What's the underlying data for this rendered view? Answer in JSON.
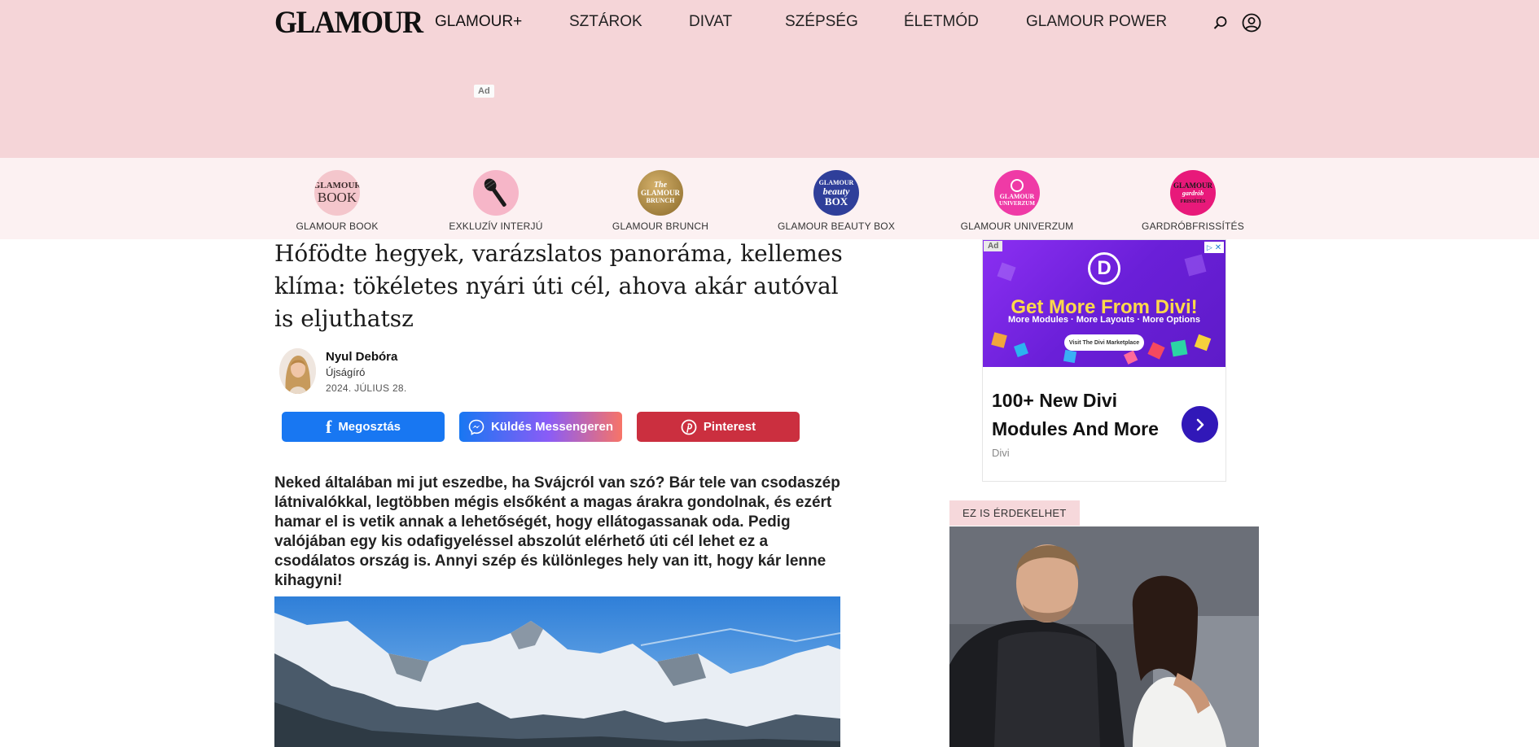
{
  "header": {
    "logo": "GLAMOUR",
    "nav": [
      "GLAMOUR+",
      "SZTÁROK",
      "DIVAT",
      "SZÉPSÉG",
      "ÉLETMÓD",
      "GLAMOUR POWER"
    ],
    "ad_label": "Ad"
  },
  "categories": [
    {
      "label": "GLAMOUR BOOK",
      "icon": "glamour-book-logo",
      "color": "#f4c6cc"
    },
    {
      "label": "EXKLUZÍV INTERJÚ",
      "icon": "microphone-icon",
      "color": "#f6b6c8"
    },
    {
      "label": "GLAMOUR BRUNCH",
      "icon": "glamour-brunch-logo",
      "color": "#b08a3a"
    },
    {
      "label": "GLAMOUR BEAUTY BOX",
      "icon": "beauty-box-logo",
      "color": "#2f3f9a"
    },
    {
      "label": "GLAMOUR UNIVERZUM",
      "icon": "univerzum-logo",
      "color": "#ef3aa6"
    },
    {
      "label": "GARDRÓBFRISSÍTÉS",
      "icon": "gardrob-logo",
      "color": "#e8197a"
    }
  ],
  "article": {
    "title": "Hófödte hegyek, varázslatos panoráma, kellemes klíma: tökéletes nyári úti cél, ahova akár autóval is eljuthatsz",
    "author": "Nyul Debóra",
    "role": "Újságíró",
    "date": "2024. JÚLIUS 28.",
    "share": {
      "facebook": "Megosztás",
      "messenger": "Küldés Messengeren",
      "pinterest": "Pinterest"
    },
    "lead": "Neked általában mi jut eszedbe, ha Svájcról van szó? Bár tele van csodaszép látnivalókkal, legtöbben mégis elsőként a magas árakra gondolnak, és ezért hamar el is vetik annak a lehetőségét, hogy ellátogassanak oda. Pedig valójában egy kis odafigyeléssel abszolút elérhető úti cél lehet ez a csodálatos ország is. Annyi szép és különleges hely van itt, hogy kár lenne kihagyni!"
  },
  "sidebar": {
    "ad": {
      "ad_label": "Ad",
      "brand_letter": "D",
      "headline": "Get More From Divi!",
      "sub": "More Modules · More Layouts · More Options",
      "cta": "Visit The Divi Marketplace",
      "title": "100+ New Divi Modules And More",
      "source": "Divi",
      "accent": "#3118b8"
    },
    "related_label": "EZ IS ÉRDEKELHET"
  },
  "colors": {
    "header_bg": "#f5d5d8",
    "strip_bg": "#fcf1f2",
    "facebook": "#1877f2",
    "pinterest": "#cb2f3f"
  }
}
